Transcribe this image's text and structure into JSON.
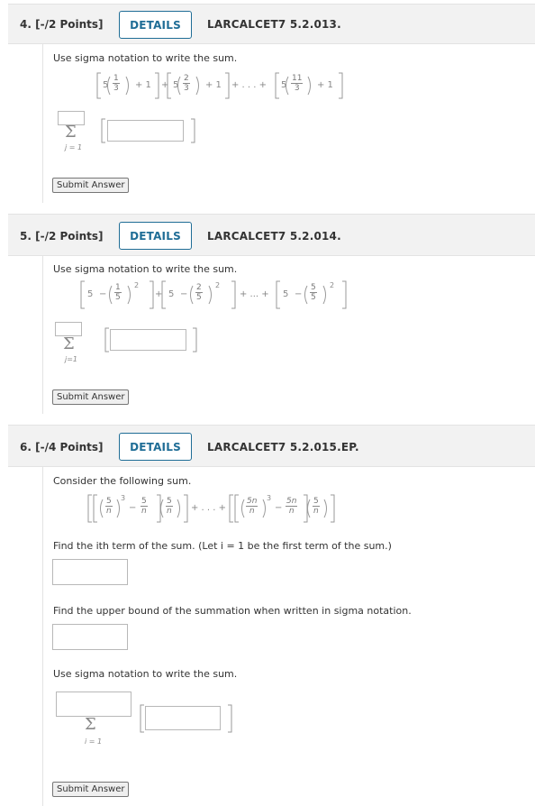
{
  "q4": {
    "number": "4.",
    "points": "[-/2 Points]",
    "details_label": "DETAILS",
    "ref": "LARCALCET7 5.2.013.",
    "prompt": "Use sigma notation to write the sum.",
    "expr": {
      "t1_coef": "5",
      "t1_num": "1",
      "t1_den": "3",
      "t2_coef": "5",
      "t2_num": "2",
      "t2_den": "3",
      "tn_coef": "5",
      "tn_num": "11",
      "tn_den": "3",
      "plus_one": "+ 1",
      "plus": "+",
      "ellipsis": "+ . . . +"
    },
    "sigma": "Σ",
    "index": "j = 1",
    "submit_label": "Submit Answer"
  },
  "q5": {
    "number": "5.",
    "points": "[-/2 Points]",
    "details_label": "DETAILS",
    "ref": "LARCALCET7 5.2.014.",
    "prompt": "Use sigma notation to write the sum.",
    "expr": {
      "five": "5",
      "minus": "−",
      "t1_num": "1",
      "t1_den": "5",
      "t2_num": "2",
      "t2_den": "5",
      "tn_num": "5",
      "tn_den": "5",
      "exp": "2",
      "plus": "+",
      "ellipsis": "+ ... +"
    },
    "sigma": "Σ",
    "index": "j=1",
    "submit_label": "Submit Answer"
  },
  "q6": {
    "number": "6.",
    "points": "[-/4 Points]",
    "details_label": "DETAILS",
    "ref": "LARCALCET7 5.2.015.EP.",
    "prompt1": "Consider the following sum.",
    "expr": {
      "a_num": "5",
      "a_den": "n",
      "b_num": "5",
      "b_den": "n",
      "c_num": "5",
      "c_den": "n",
      "d_num": "5n",
      "d_den": "n",
      "e_num": "5n",
      "e_den": "n",
      "f_num": "5",
      "f_den": "n",
      "exp": "3",
      "minus": "−",
      "ellipsis": "+ . . . +"
    },
    "prompt2": "Find the ith term of the sum. (Let i = 1 be the first term of the sum.)",
    "prompt3": "Find the upper bound of the summation when written in sigma notation.",
    "prompt4": "Use sigma notation to write the sum.",
    "sigma": "Σ",
    "index": "i = 1",
    "submit_label": "Submit Answer"
  }
}
